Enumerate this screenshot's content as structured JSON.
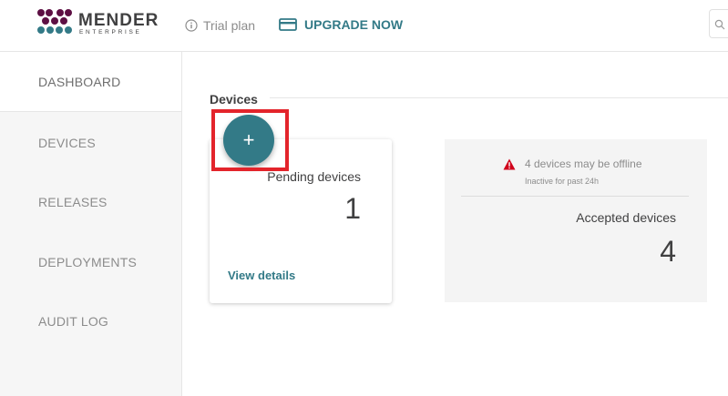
{
  "header": {
    "logo": {
      "name": "MENDER",
      "subtitle": "ENTERPRISE"
    },
    "trial_label": "Trial plan",
    "upgrade_label": "UPGRADE NOW"
  },
  "sidebar": {
    "items": [
      {
        "label": "DASHBOARD",
        "active": true
      },
      {
        "label": "DEVICES"
      },
      {
        "label": "RELEASES"
      },
      {
        "label": "DEPLOYMENTS"
      },
      {
        "label": "AUDIT LOG"
      }
    ]
  },
  "main": {
    "section_title": "Devices",
    "pending": {
      "label": "Pending devices",
      "count": "1",
      "link": "View details"
    },
    "add_button_glyph": "+",
    "accepted": {
      "warning": "4 devices may be offline",
      "warning_sub": "Inactive for past 24h",
      "label": "Accepted devices",
      "count": "4"
    }
  },
  "colors": {
    "accent": "#337a87",
    "brand_purple": "#5d0f43",
    "highlight": "#e3242b",
    "warning": "#d0021b"
  }
}
